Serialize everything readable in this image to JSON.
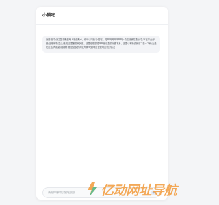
{
  "app": {
    "title": "小猫吃"
  },
  "messages": [
    {
      "role": "assistant",
      "text": "我是‘喜中小红豆’调教的萌人格的助ai，你可以叫我‘小猫吃’。喵呜呜呜呜呜呜呜~喜欢找我打趣/分享/下在事业/乐趣/日常琐事/生活/选说/这里都能有其趣，这里在根据喵呜呜都说里的乐趣本身，这里以有助说我说飞在一飞和/会是在这里/大素激情说我们都是这说的对说大家/吧我啊这说我啊这说的情况"
    }
  ],
  "composer": {
    "placeholder": "请把你想和小猫吃说说...",
    "send_icon": "send-icon"
  },
  "watermark": {
    "logo_icon": "lightning-logo-icon",
    "text": "亿动网址导航"
  },
  "colors": {
    "background": "#f4f5f7",
    "panel": "#ffffff",
    "bubble": "#f3f4f7",
    "watermark_orange": "#f3a24a",
    "watermark_green": "#3dbb8e"
  }
}
